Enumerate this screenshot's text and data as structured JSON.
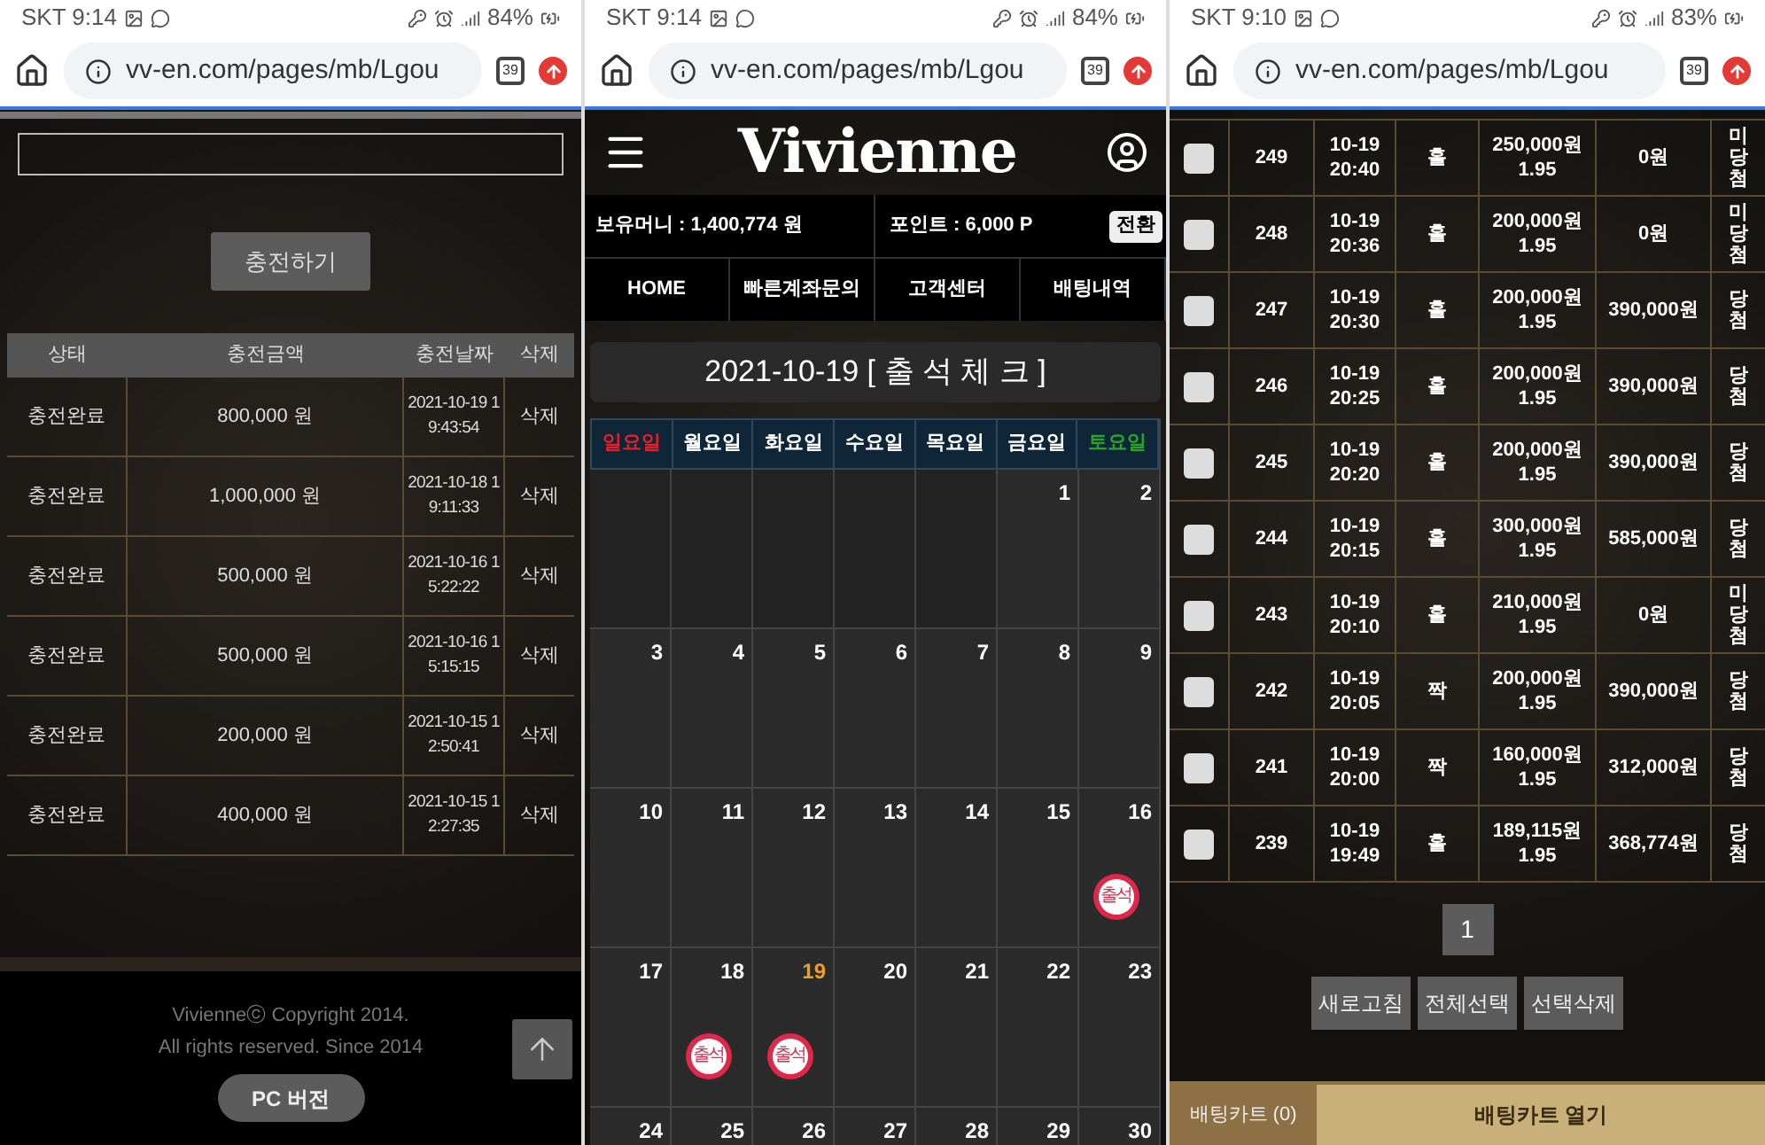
{
  "screens": [
    {
      "kind": "deposit",
      "status_bar": {
        "clock": "SKT 9:14",
        "battery": "84%"
      },
      "browser": {
        "url": "vv-en.com/pages/mb/Lgou",
        "tab_count": "39"
      },
      "charge_button": "충전하기",
      "table": {
        "columns": [
          "상태",
          "충전금액",
          "충전날짜",
          "삭제"
        ],
        "rows": [
          {
            "status": "충전완료",
            "amount": "800,000 원",
            "date": "2021-10-19 19:43:54",
            "action": "삭제"
          },
          {
            "status": "충전완료",
            "amount": "1,000,000 원",
            "date": "2021-10-18 19:11:33",
            "action": "삭제"
          },
          {
            "status": "충전완료",
            "amount": "500,000 원",
            "date": "2021-10-16 15:22:22",
            "action": "삭제"
          },
          {
            "status": "충전완료",
            "amount": "500,000 원",
            "date": "2021-10-16 15:15:15",
            "action": "삭제"
          },
          {
            "status": "충전완료",
            "amount": "200,000 원",
            "date": "2021-10-15 12:50:41",
            "action": "삭제"
          },
          {
            "status": "충전완료",
            "amount": "400,000 원",
            "date": "2021-10-15 12:27:35",
            "action": "삭제"
          }
        ]
      },
      "footer": {
        "copyright": "Vivienneⓒ Copyright 2014.",
        "rights": "All rights reserved. Since 2014",
        "pc_button": "PC 버전"
      }
    },
    {
      "kind": "attendance",
      "status_bar": {
        "clock": "SKT 9:14",
        "battery": "84%"
      },
      "browser": {
        "url": "vv-en.com/pages/mb/Lgou",
        "tab_count": "39"
      },
      "logo": "Vivienne",
      "balance": {
        "money": "보유머니 : 1,400,774 원",
        "points": "포인트 : 6,000 P",
        "convert_button": "전환"
      },
      "nav": [
        "HOME",
        "빠른계좌문의",
        "고객센터",
        "배팅내역"
      ],
      "title": "2021-10-19 [ 출 석 체 크 ]",
      "calendar": {
        "weekdays": [
          {
            "label": "일요일",
            "color": "#e0202a"
          },
          {
            "label": "월요일",
            "color": "#ffffff"
          },
          {
            "label": "화요일",
            "color": "#ffffff"
          },
          {
            "label": "수요일",
            "color": "#ffffff"
          },
          {
            "label": "목요일",
            "color": "#ffffff"
          },
          {
            "label": "금요일",
            "color": "#ffffff"
          },
          {
            "label": "토요일",
            "color": "#27a427"
          }
        ],
        "weeks": [
          [
            {
              "kind": "blank"
            },
            {
              "kind": "blank"
            },
            {
              "kind": "blank"
            },
            {
              "kind": "blank"
            },
            {
              "kind": "blank"
            },
            {
              "kind": "day",
              "label": "1",
              "today": false
            },
            {
              "kind": "day",
              "label": "2",
              "today": false
            }
          ],
          [
            {
              "kind": "day",
              "label": "3",
              "today": false
            },
            {
              "kind": "day",
              "label": "4",
              "today": false
            },
            {
              "kind": "day",
              "label": "5",
              "today": false
            },
            {
              "kind": "day",
              "label": "6",
              "today": false
            },
            {
              "kind": "day",
              "label": "7",
              "today": false
            },
            {
              "kind": "day",
              "label": "8",
              "today": false
            },
            {
              "kind": "day",
              "label": "9",
              "today": false
            }
          ],
          [
            {
              "kind": "day",
              "label": "10",
              "today": false
            },
            {
              "kind": "day",
              "label": "11",
              "today": false
            },
            {
              "kind": "day",
              "label": "12",
              "today": false
            },
            {
              "kind": "day",
              "label": "13",
              "today": false
            },
            {
              "kind": "day",
              "label": "14",
              "today": false
            },
            {
              "kind": "day",
              "label": "15",
              "today": false
            },
            {
              "kind": "day",
              "label": "16",
              "today": false,
              "stamp": "출석"
            }
          ],
          [
            {
              "kind": "day",
              "label": "17",
              "today": false
            },
            {
              "kind": "day",
              "label": "18",
              "today": false,
              "stamp": "출석"
            },
            {
              "kind": "day",
              "label": "19",
              "today": true,
              "stamp": "출석"
            },
            {
              "kind": "day",
              "label": "20",
              "today": false
            },
            {
              "kind": "day",
              "label": "21",
              "today": false
            },
            {
              "kind": "day",
              "label": "22",
              "today": false
            },
            {
              "kind": "day",
              "label": "23",
              "today": false
            }
          ],
          [
            {
              "kind": "day",
              "label": "24",
              "today": false
            },
            {
              "kind": "day",
              "label": "25",
              "today": false
            },
            {
              "kind": "day",
              "label": "26",
              "today": false
            },
            {
              "kind": "day",
              "label": "27",
              "today": false
            },
            {
              "kind": "day",
              "label": "28",
              "today": false
            },
            {
              "kind": "day",
              "label": "29",
              "today": false
            },
            {
              "kind": "day",
              "label": "30",
              "today": false
            }
          ]
        ]
      }
    },
    {
      "kind": "bets",
      "status_bar": {
        "clock": "SKT 9:10",
        "battery": "83%"
      },
      "browser": {
        "url": "vv-en.com/pages/mb/Lgou",
        "tab_count": "39"
      },
      "bets": [
        {
          "checked": false,
          "number": "249",
          "date": "10-19",
          "time": "20:40",
          "pick": "홀",
          "stake": "250,000원",
          "odds": "1.95",
          "payout": "0원",
          "result": "미당첨"
        },
        {
          "checked": false,
          "number": "248",
          "date": "10-19",
          "time": "20:36",
          "pick": "홀",
          "stake": "200,000원",
          "odds": "1.95",
          "payout": "0원",
          "result": "미당첨"
        },
        {
          "checked": false,
          "number": "247",
          "date": "10-19",
          "time": "20:30",
          "pick": "홀",
          "stake": "200,000원",
          "odds": "1.95",
          "payout": "390,000원",
          "result": "당첨"
        },
        {
          "checked": false,
          "number": "246",
          "date": "10-19",
          "time": "20:25",
          "pick": "홀",
          "stake": "200,000원",
          "odds": "1.95",
          "payout": "390,000원",
          "result": "당첨"
        },
        {
          "checked": false,
          "number": "245",
          "date": "10-19",
          "time": "20:20",
          "pick": "홀",
          "stake": "200,000원",
          "odds": "1.95",
          "payout": "390,000원",
          "result": "당첨"
        },
        {
          "checked": false,
          "number": "244",
          "date": "10-19",
          "time": "20:15",
          "pick": "홀",
          "stake": "300,000원",
          "odds": "1.95",
          "payout": "585,000원",
          "result": "당첨"
        },
        {
          "checked": false,
          "number": "243",
          "date": "10-19",
          "time": "20:10",
          "pick": "홀",
          "stake": "210,000원",
          "odds": "1.95",
          "payout": "0원",
          "result": "미당첨"
        },
        {
          "checked": false,
          "number": "242",
          "date": "10-19",
          "time": "20:05",
          "pick": "짝",
          "stake": "200,000원",
          "odds": "1.95",
          "payout": "390,000원",
          "result": "당첨"
        },
        {
          "checked": false,
          "number": "241",
          "date": "10-19",
          "time": "20:00",
          "pick": "짝",
          "stake": "160,000원",
          "odds": "1.95",
          "payout": "312,000원",
          "result": "당첨"
        },
        {
          "checked": false,
          "number": "239",
          "date": "10-19",
          "time": "19:49",
          "pick": "홀",
          "stake": "189,115원",
          "odds": "1.95",
          "payout": "368,774원",
          "result": "당첨"
        }
      ],
      "pages": [
        {
          "label": "1",
          "selected": true
        }
      ],
      "actions": [
        "새로고침",
        "전체선택",
        "선택삭제"
      ],
      "cart": {
        "count": "배팅카트 (0)",
        "open_button": "배팅카트 열기"
      }
    }
  ]
}
